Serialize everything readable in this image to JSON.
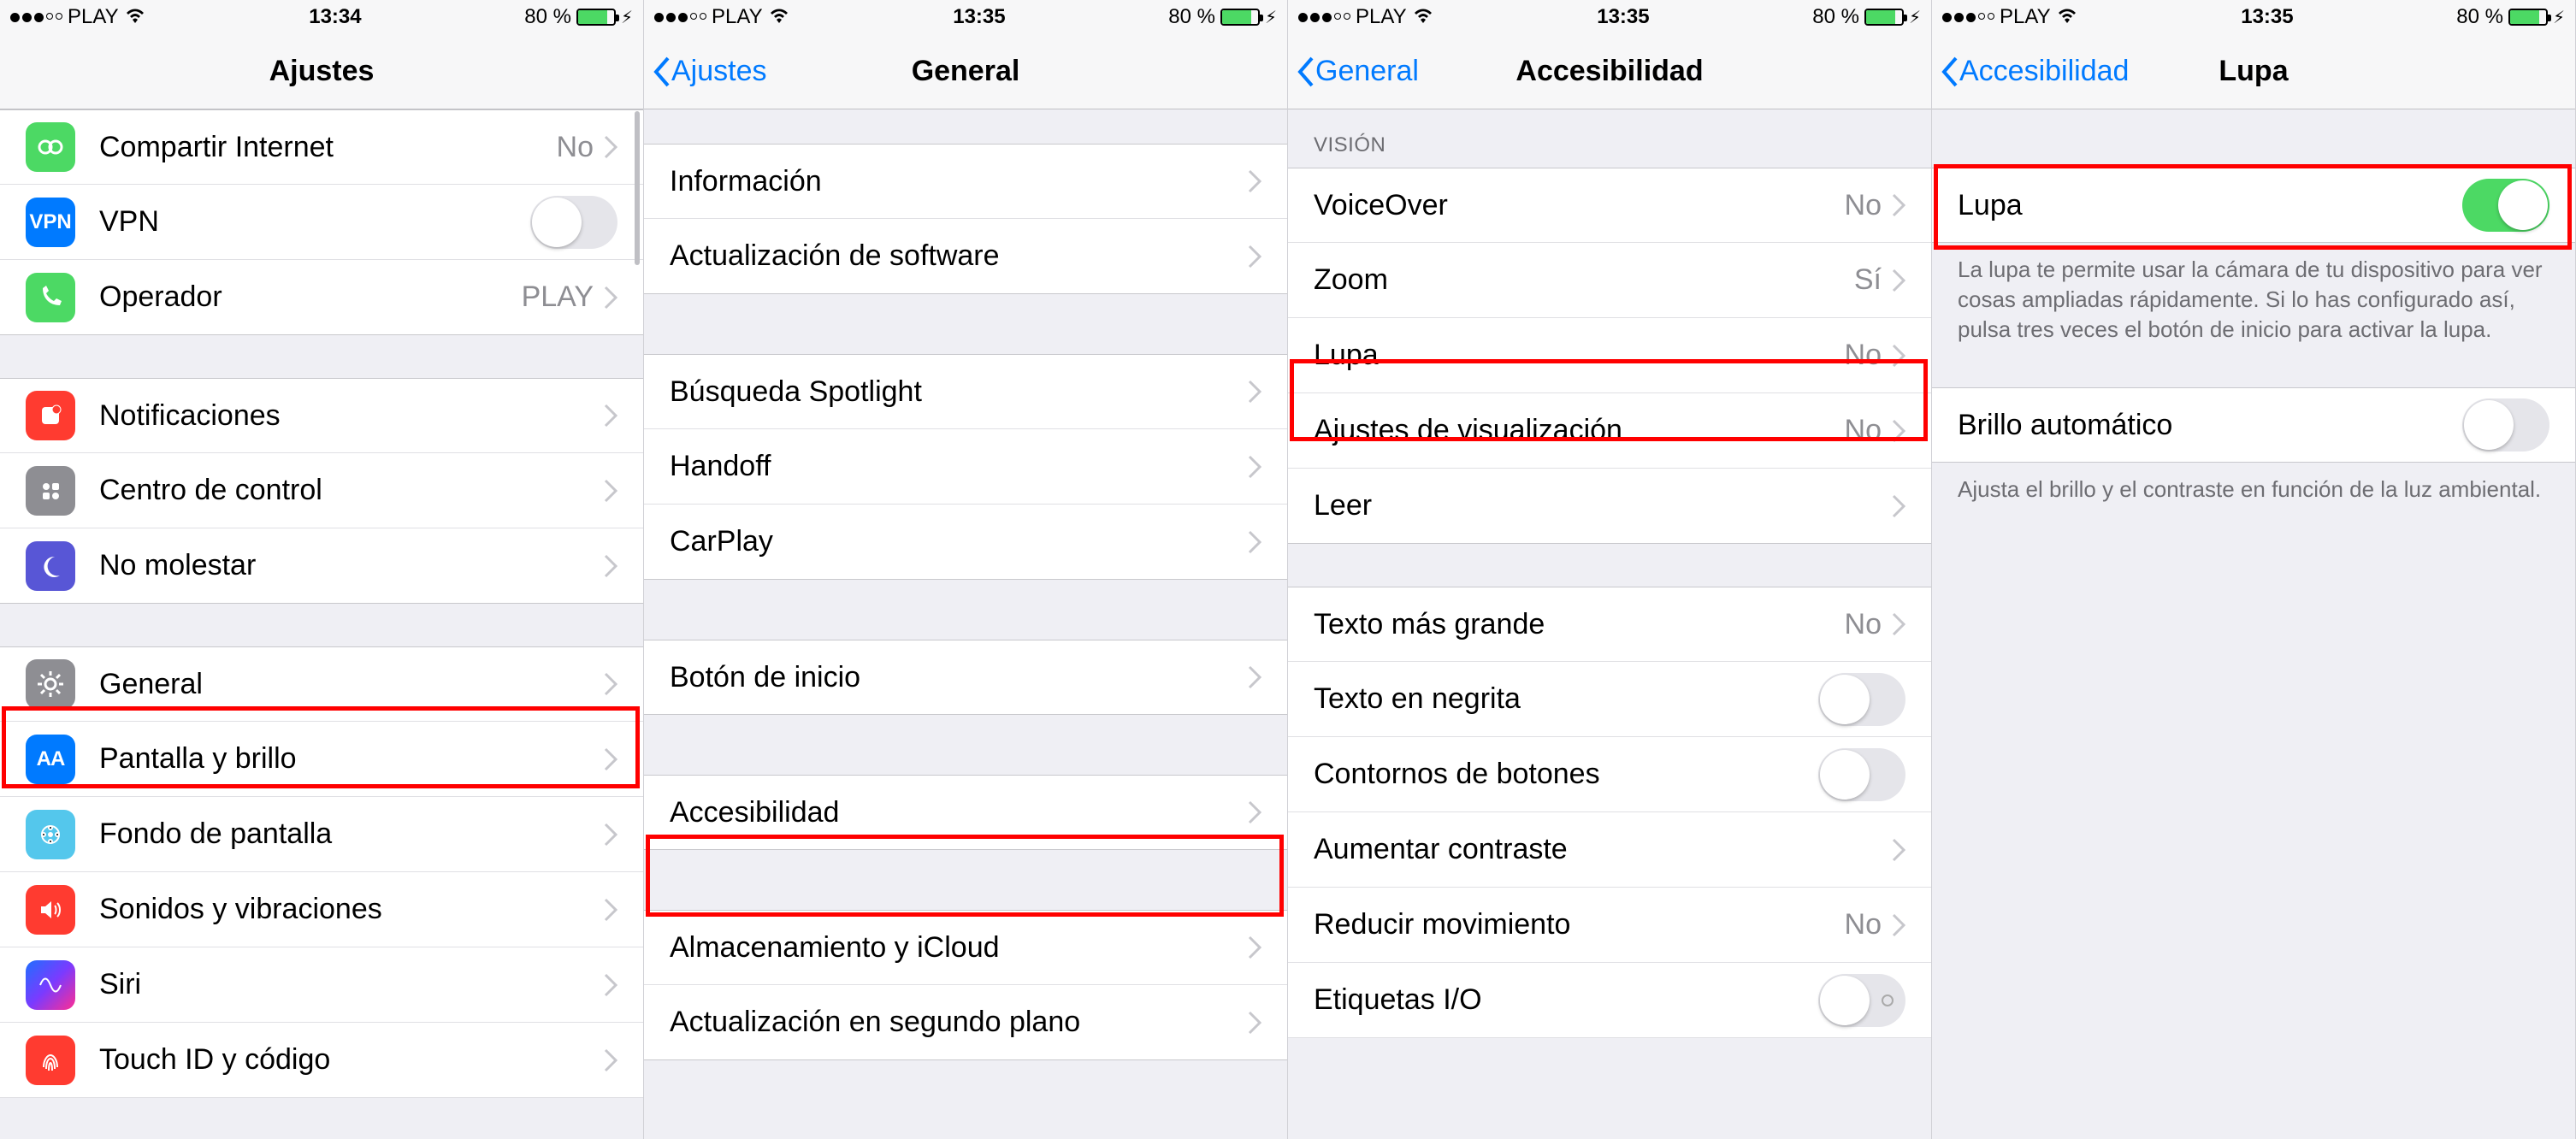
{
  "status": {
    "carrier": "PLAY",
    "battery_pct": "80 %",
    "battery_fill_pct": 80,
    "times": [
      "13:34",
      "13:35",
      "13:35",
      "13:35"
    ]
  },
  "pane1": {
    "title": "Ajustes",
    "rows": {
      "hotspot": {
        "label": "Compartir Internet",
        "value": "No"
      },
      "vpn": {
        "label": "VPN"
      },
      "carrier": {
        "label": "Operador",
        "value": "PLAY"
      },
      "notif": {
        "label": "Notificaciones"
      },
      "cc": {
        "label": "Centro de control"
      },
      "dnd": {
        "label": "No molestar"
      },
      "general": {
        "label": "General"
      },
      "display": {
        "label": "Pantalla y brillo"
      },
      "wall": {
        "label": "Fondo de pantalla"
      },
      "sound": {
        "label": "Sonidos y vibraciones"
      },
      "siri": {
        "label": "Siri"
      },
      "touchid": {
        "label": "Touch ID y código"
      }
    }
  },
  "pane2": {
    "back": "Ajustes",
    "title": "General",
    "rows": {
      "about": {
        "label": "Información"
      },
      "swupd": {
        "label": "Actualización de software"
      },
      "spot": {
        "label": "Búsqueda Spotlight"
      },
      "handoff": {
        "label": "Handoff"
      },
      "carplay": {
        "label": "CarPlay"
      },
      "home": {
        "label": "Botón de inicio"
      },
      "acc": {
        "label": "Accesibilidad"
      },
      "storage": {
        "label": "Almacenamiento y iCloud"
      },
      "bg": {
        "label": "Actualización en segundo plano"
      }
    }
  },
  "pane3": {
    "back": "General",
    "title": "Accesibilidad",
    "section_vision": "VISIÓN",
    "rows": {
      "voiceover": {
        "label": "VoiceOver",
        "value": "No"
      },
      "zoom": {
        "label": "Zoom",
        "value": "Sí"
      },
      "lupa": {
        "label": "Lupa",
        "value": "No"
      },
      "disp": {
        "label": "Ajustes de visualización",
        "value": "No"
      },
      "speak": {
        "label": "Leer"
      },
      "larger": {
        "label": "Texto más grande",
        "value": "No"
      },
      "bold": {
        "label": "Texto en negrita"
      },
      "shapes": {
        "label": "Contornos de botones"
      },
      "contrast": {
        "label": "Aumentar contraste"
      },
      "reduce": {
        "label": "Reducir movimiento",
        "value": "No"
      },
      "labels": {
        "label": "Etiquetas I/O"
      }
    }
  },
  "pane4": {
    "back": "Accesibilidad",
    "title": "Lupa",
    "rows": {
      "lupa": {
        "label": "Lupa",
        "on": true
      },
      "brightness": {
        "label": "Brillo automático",
        "on": false
      }
    },
    "footer_lupa": "La lupa te permite usar la cámara de tu dispositivo para ver cosas ampliadas rápidamente. Si lo has configurado así, pulsa tres veces el botón de inicio para activar la lupa.",
    "footer_brightness": "Ajusta el brillo y el contraste en función de la luz ambiental."
  }
}
